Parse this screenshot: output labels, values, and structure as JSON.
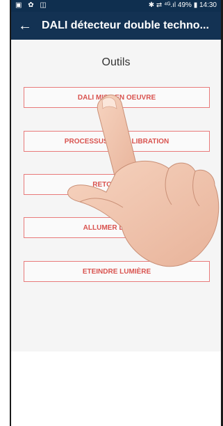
{
  "status_bar": {
    "left_icons": "▣ ✿ ◫",
    "right_text": "✱ ⇄ ⁴ᴳ.ıl 49% ▮ 14:30"
  },
  "app_bar": {
    "back_icon": "←",
    "title": "DALI détecteur double techno..."
  },
  "section_title": "Outils",
  "buttons": [
    "DALI MISE EN OEUVRE",
    "PROCESSUS DE CALIBRATION",
    "RETOUR ÉTAT",
    "ALLUMER LUMIÈRE",
    "ETEINDRE LUMIÈRE"
  ],
  "colors": {
    "app_bar": "#133253",
    "button_border": "#e87a7a",
    "button_text": "#d9534f"
  },
  "overlay": "pointing-hand-icon"
}
